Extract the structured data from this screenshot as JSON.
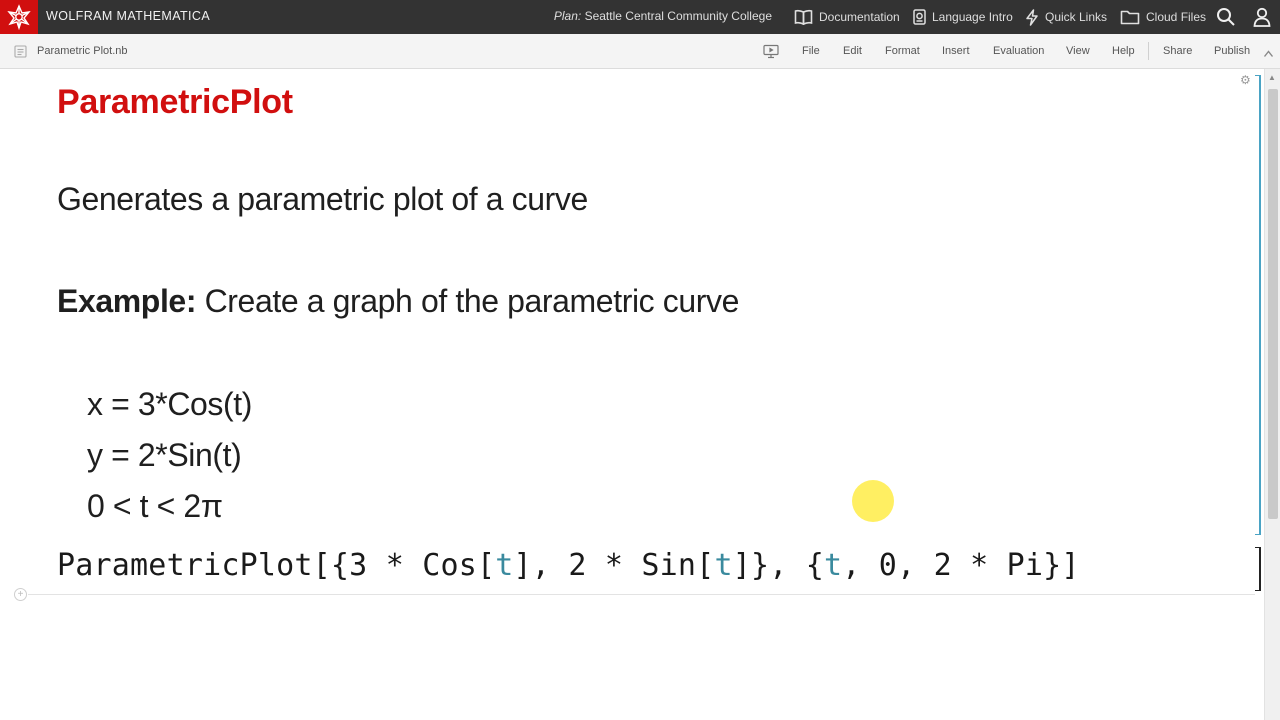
{
  "topbar": {
    "brand": "WOLFRAM MATHEMATICA",
    "plan_label": "Plan:",
    "plan_value": "Seattle Central Community College",
    "links": {
      "documentation": "Documentation",
      "language_intro": "Language Intro",
      "quick_links": "Quick Links",
      "cloud_files": "Cloud Files"
    },
    "icons": [
      "spikey-logo-icon",
      "book-icon",
      "document-icon",
      "lightning-icon",
      "folder-icon",
      "search-icon",
      "user-icon"
    ],
    "colors": {
      "bar": "#333333",
      "brand_red": "#d10f0f"
    }
  },
  "menubar": {
    "notebook_name": "Parametric Plot.nb",
    "items": {
      "file": "File",
      "edit": "Edit",
      "format": "Format",
      "insert": "Insert",
      "evaluation": "Evaluation",
      "view": "View",
      "help": "Help",
      "share": "Share",
      "publish": "Publish"
    }
  },
  "notebook": {
    "title": "ParametricPlot",
    "description": "Generates a  parametric plot of a curve",
    "example_label": "Example:",
    "example_text": " Create a graph of the parametric curve",
    "equations": {
      "x": "x = 3*Cos(t)",
      "y": "y = 2*Sin(t)",
      "t_range": "0 < t < 2π"
    },
    "input_code": {
      "p1": "ParametricPlot[{3 * Cos[",
      "v1": "t",
      "p2": "], 2 * Sin[",
      "v2": "t",
      "p3": "]}, {",
      "v3": "t",
      "p4": ", 0, 2 * Pi}]"
    },
    "colors": {
      "title": "#d10f0f",
      "variable": "#3a8a9e",
      "text_cell_bracket": "#4aa3c4"
    }
  }
}
